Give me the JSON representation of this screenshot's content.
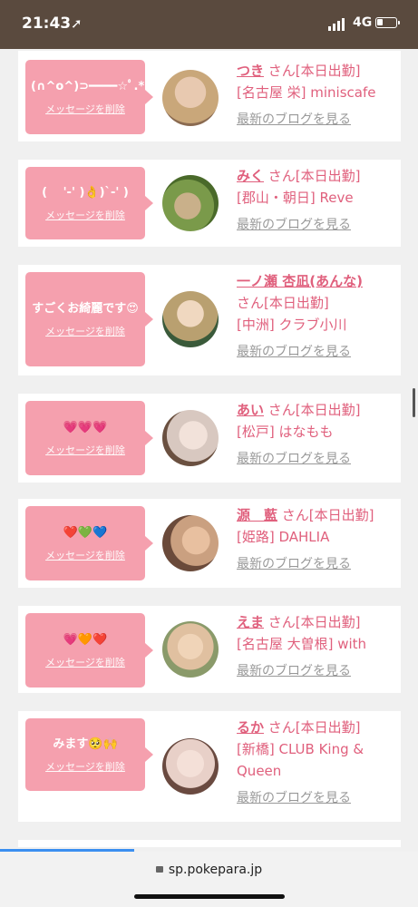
{
  "status": {
    "time": "21:43",
    "location_icon": "location-arrow-icon",
    "network": "4G",
    "battery_fraction": 0.3
  },
  "cards": [
    {
      "message": "(∩^o^)⊃━━━━☆ﾟ.*",
      "delete_label": "メッセージを削除",
      "name": "つき",
      "san": "さん[本日出勤]",
      "shop": "[名古屋 栄] miniscafe",
      "blog": "最新のブログを見る",
      "avatar_colors": [
        "#c9a77a",
        "#8a6a50"
      ]
    },
    {
      "message": "( 　'-' )👌)`-' )",
      "delete_label": "メッセージを削除",
      "name": "みく",
      "san": "さん[本日出勤]",
      "shop": "[郡山・朝日] Reve",
      "blog": "最新のブログを見る",
      "avatar_colors": [
        "#5a7a3a",
        "#c9b08a"
      ]
    },
    {
      "message": "すごくお綺麗です😍",
      "delete_label": "メッセージを削除",
      "name": "一ノ瀬 杏凪(あんな)",
      "san": "さん[本日出勤]",
      "shop": "[中洲] クラブ小川",
      "blog": "最新のブログを見る",
      "avatar_colors": [
        "#b9a070",
        "#3a5a3a"
      ]
    },
    {
      "message": "💗💗💗",
      "delete_label": "メッセージを削除",
      "name": "あい",
      "san": "さん[本日出勤]",
      "shop": "[松戸] はなもも",
      "blog": "最新のブログを見る",
      "avatar_colors": [
        "#d8c8c0",
        "#6a5040"
      ]
    },
    {
      "message": "❤️💚💙",
      "delete_label": "メッセージを削除",
      "name": "源　藍",
      "san": "さん[本日出勤]",
      "shop": "[姫路] DAHLIA",
      "blog": "最新のブログを見る",
      "avatar_colors": [
        "#6a4a3a",
        "#caa080"
      ]
    },
    {
      "message": "💗🧡❤️",
      "delete_label": "メッセージを削除",
      "name": "えま",
      "san": "さん[本日出勤]",
      "shop": "[名古屋 大曽根] with",
      "blog": "最新のブログを見る",
      "avatar_colors": [
        "#8a9a6a",
        "#e0c0a0"
      ]
    },
    {
      "message": "みます🥺🙌",
      "delete_label": "メッセージを削除",
      "name": "るか",
      "san": "さん[本日出勤]",
      "shop": "[新橋] CLUB King & Queen",
      "blog": "最新のブログを見る",
      "avatar_colors": [
        "#e8d0c8",
        "#6a4a40"
      ]
    }
  ],
  "browser": {
    "url": "sp.pokepara.jp",
    "load_progress": 0.32
  },
  "colors": {
    "accent": "#e0607d",
    "bubble": "#f5a0ae",
    "statusbar": "#5a4a3e"
  }
}
